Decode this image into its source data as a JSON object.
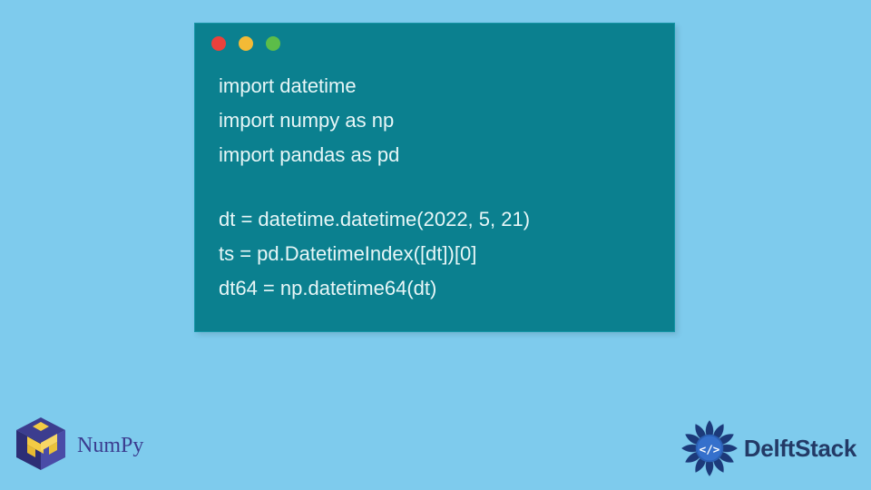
{
  "code": {
    "lines": [
      "import datetime",
      "import numpy as np",
      "import pandas as pd",
      "",
      "dt = datetime.datetime(2022, 5, 21)",
      "ts = pd.DatetimeIndex([dt])[0]",
      "dt64 = np.datetime64(dt)"
    ]
  },
  "branding": {
    "numpy_label": "NumPy",
    "delft_label": "DelftStack"
  },
  "colors": {
    "bg": "#7ecbed",
    "window": "#0b808f",
    "numpy_text": "#3b3c8f",
    "delft_text": "#233a66"
  }
}
